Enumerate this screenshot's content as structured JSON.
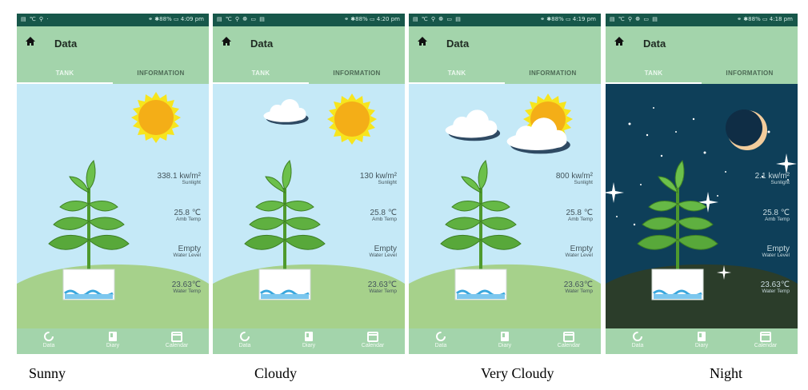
{
  "colors": {
    "status_bar": "#17574a",
    "app_green": "#a3d4ab",
    "sky_day": "#c5e9f7",
    "sky_night": "#0e3f59",
    "ground_day": "#a6d18b",
    "ground_night": "#2b3d2a",
    "sun": "#f4ae17",
    "moon": "#f2cc9c"
  },
  "icons": {
    "home": "home-icon",
    "data": "data-ring-icon",
    "diary": "book-icon",
    "calendar": "calendar-icon"
  },
  "screens": [
    {
      "status_left": "▤ ℃ ⚲ ·",
      "status_right": "⚭ ✱88% ▭ 4:09 pm",
      "header_title": "Data",
      "tab_active": "TANK",
      "tab_other": "INFORMATION",
      "weather": "sunny",
      "sunlight_value": "338.1 kw/m²",
      "sunlight_label": "Sunlight",
      "amb_value": "25.8 ℃",
      "amb_label": "Amb Temp",
      "water_level_value": "Empty",
      "water_level_label": "Water Level",
      "water_temp_value": "23.63℃",
      "water_temp_label": "Water Temp",
      "nav": [
        "Data",
        "Diary",
        "Calendar"
      ],
      "caption": "Sunny"
    },
    {
      "status_left": "▤ ℃ ⚲ ❁ ▭ ▤",
      "status_right": "⚭ ✱88% ▭ 4:20 pm",
      "header_title": "Data",
      "tab_active": "TANK",
      "tab_other": "INFORMATION",
      "weather": "cloudy",
      "sunlight_value": "130 kw/m²",
      "sunlight_label": "Sunlight",
      "amb_value": "25.8 ℃",
      "amb_label": "Amb Temp",
      "water_level_value": "Empty",
      "water_level_label": "Water Level",
      "water_temp_value": "23.63℃",
      "water_temp_label": "Water Temp",
      "nav": [
        "Data",
        "Diary",
        "Calendar"
      ],
      "caption": "Cloudy"
    },
    {
      "status_left": "▤ ℃ ⚲ ❁ ▭ ▤",
      "status_right": "⚭ ✱88% ▭ 4:19 pm",
      "header_title": "Data",
      "tab_active": "TANK",
      "tab_other": "INFORMATION",
      "weather": "very cloudy",
      "sunlight_value": "800 kw/m²",
      "sunlight_label": "Sunlight",
      "amb_value": "25.8 ℃",
      "amb_label": "Amb Temp",
      "water_level_value": "Empty",
      "water_level_label": "Water Level",
      "water_temp_value": "23.63℃",
      "water_temp_label": "Water Temp",
      "nav": [
        "Data",
        "Diary",
        "Calendar"
      ],
      "caption": "Very Cloudy"
    },
    {
      "status_left": "▤ ℃ ⚲ ❁ ▭ ▤",
      "status_right": "⚭ ✱88% ▭ 4:18 pm",
      "header_title": "Data",
      "tab_active": "TANK",
      "tab_other": "INFORMATION",
      "weather": "night",
      "sunlight_value": "2.1 kw/m²",
      "sunlight_label": "Sunlight",
      "amb_value": "25.8 ℃",
      "amb_label": "Amb Temp",
      "water_level_value": "Empty",
      "water_level_label": "Water Level",
      "water_temp_value": "23.63℃",
      "water_temp_label": "Water Temp",
      "nav": [
        "Data",
        "Diary",
        "Calendar"
      ],
      "caption": "Night"
    }
  ]
}
